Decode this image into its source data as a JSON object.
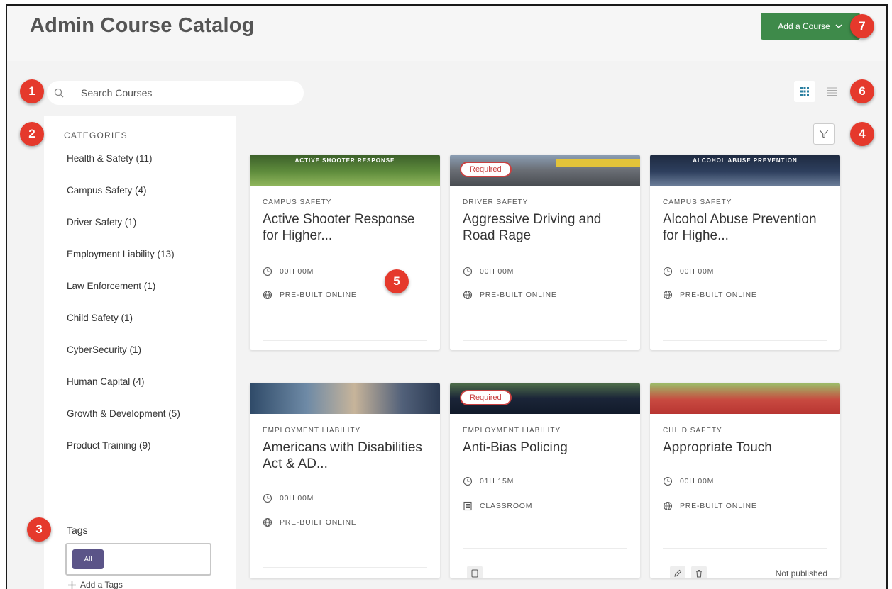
{
  "header": {
    "title": "Admin Course Catalog",
    "add_course_label": "Add a Course"
  },
  "search": {
    "placeholder": "Search Courses"
  },
  "sidebar": {
    "categories_heading": "CATEGORIES",
    "categories": [
      "Health & Safety (11)",
      "Campus Safety (4)",
      "Driver Safety (1)",
      "Employment Liability (13)",
      "Law Enforcement (1)",
      "Child Safety (1)",
      "CyberSecurity (1)",
      "Human Capital (4)",
      "Growth & Development (5)",
      "Product Training (9)"
    ],
    "tags_label": "Tags",
    "tag_chip": "All",
    "add_tags": "Add a Tags"
  },
  "courses": [
    {
      "category": "CAMPUS SAFETY",
      "title": "Active Shooter Response for Higher...",
      "duration": "00H 00M",
      "format": "PRE-BUILT ONLINE",
      "thumb_text": "ACTIVE SHOOTER RESPONSE",
      "thumb_color": "#4d7a34"
    },
    {
      "category": "DRIVER SAFETY",
      "title": "Aggressive Driving and Road Rage",
      "duration": "00H 00M",
      "format": "PRE-BUILT ONLINE",
      "badge": "Required",
      "thumb_color": "#6b6f78"
    },
    {
      "category": "CAMPUS SAFETY",
      "title": "Alcohol Abuse Prevention for Highe...",
      "duration": "00H 00M",
      "format": "PRE-BUILT ONLINE",
      "thumb_text": "ALCOHOL ABUSE PREVENTION",
      "thumb_color": "#23324a"
    },
    {
      "category": "EMPLOYMENT LIABILITY",
      "title": "Americans with Disabilities Act & AD...",
      "duration": "00H 00M",
      "format": "PRE-BUILT ONLINE",
      "thumb_color": "#3e5f7e"
    },
    {
      "category": "EMPLOYMENT LIABILITY",
      "title": "Anti-Bias Policing",
      "duration": "01H 15M",
      "format": "CLASSROOM",
      "badge": "Required",
      "thumb_color": "#1f2b40"
    },
    {
      "category": "CHILD SAFETY",
      "title": "Appropriate Touch",
      "duration": "00H 00M",
      "format": "PRE-BUILT ONLINE",
      "status": "Not published",
      "thumb_color": "#b63a36"
    }
  ],
  "colors": {
    "accent_green": "#3e8a4a",
    "step_red": "#e5392c",
    "required_red": "#c94040",
    "tag_purple": "#5b5488"
  },
  "steps": [
    "1",
    "2",
    "3",
    "4",
    "5",
    "6",
    "7"
  ]
}
